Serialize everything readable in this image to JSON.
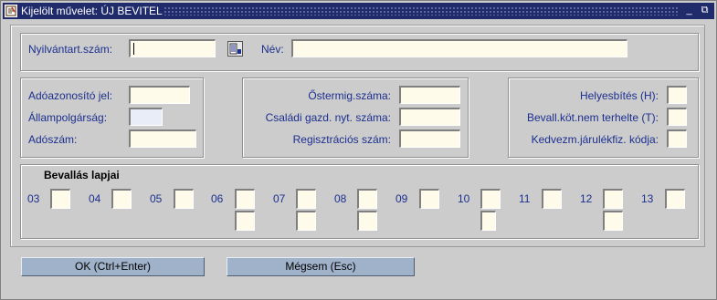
{
  "window": {
    "title": "Kijelölt művelet: ÚJ BEVITEL",
    "minimize": "_",
    "restore": "⧉"
  },
  "header": {
    "nyilv_label": "Nyilvántart.szám:",
    "nyilv_value": "",
    "nev_label": "Név:",
    "nev_value": ""
  },
  "left_group": {
    "adoazonosito_label": "Adóazonosító jel:",
    "allampolgarsag_label": "Állampolgárság:",
    "adoszam_label": "Adószám:"
  },
  "middle_group": {
    "osterm_label": "Őstermig.száma:",
    "csaladi_label": "Családi gazd. nyt. száma:",
    "regisztracios_label": "Regisztrációs szám:"
  },
  "right_group": {
    "helyesbites_label": "Helyesbítés (H):",
    "bevall_label": "Bevall.köt.nem terhelte (T):",
    "kedvezm_label": "Kedvezm.járulékfiz. kódja:"
  },
  "pages": {
    "title": "Bevallás lapjai",
    "numbers": [
      "03",
      "04",
      "05",
      "06",
      "07",
      "08",
      "09",
      "10",
      "11",
      "12",
      "13"
    ]
  },
  "buttons": {
    "ok_label": "OK (Ctrl+Enter)",
    "cancel_label": "Mégsem (Esc)"
  },
  "icons": {
    "app": "form-icon",
    "lov": "list-of-values-icon"
  }
}
